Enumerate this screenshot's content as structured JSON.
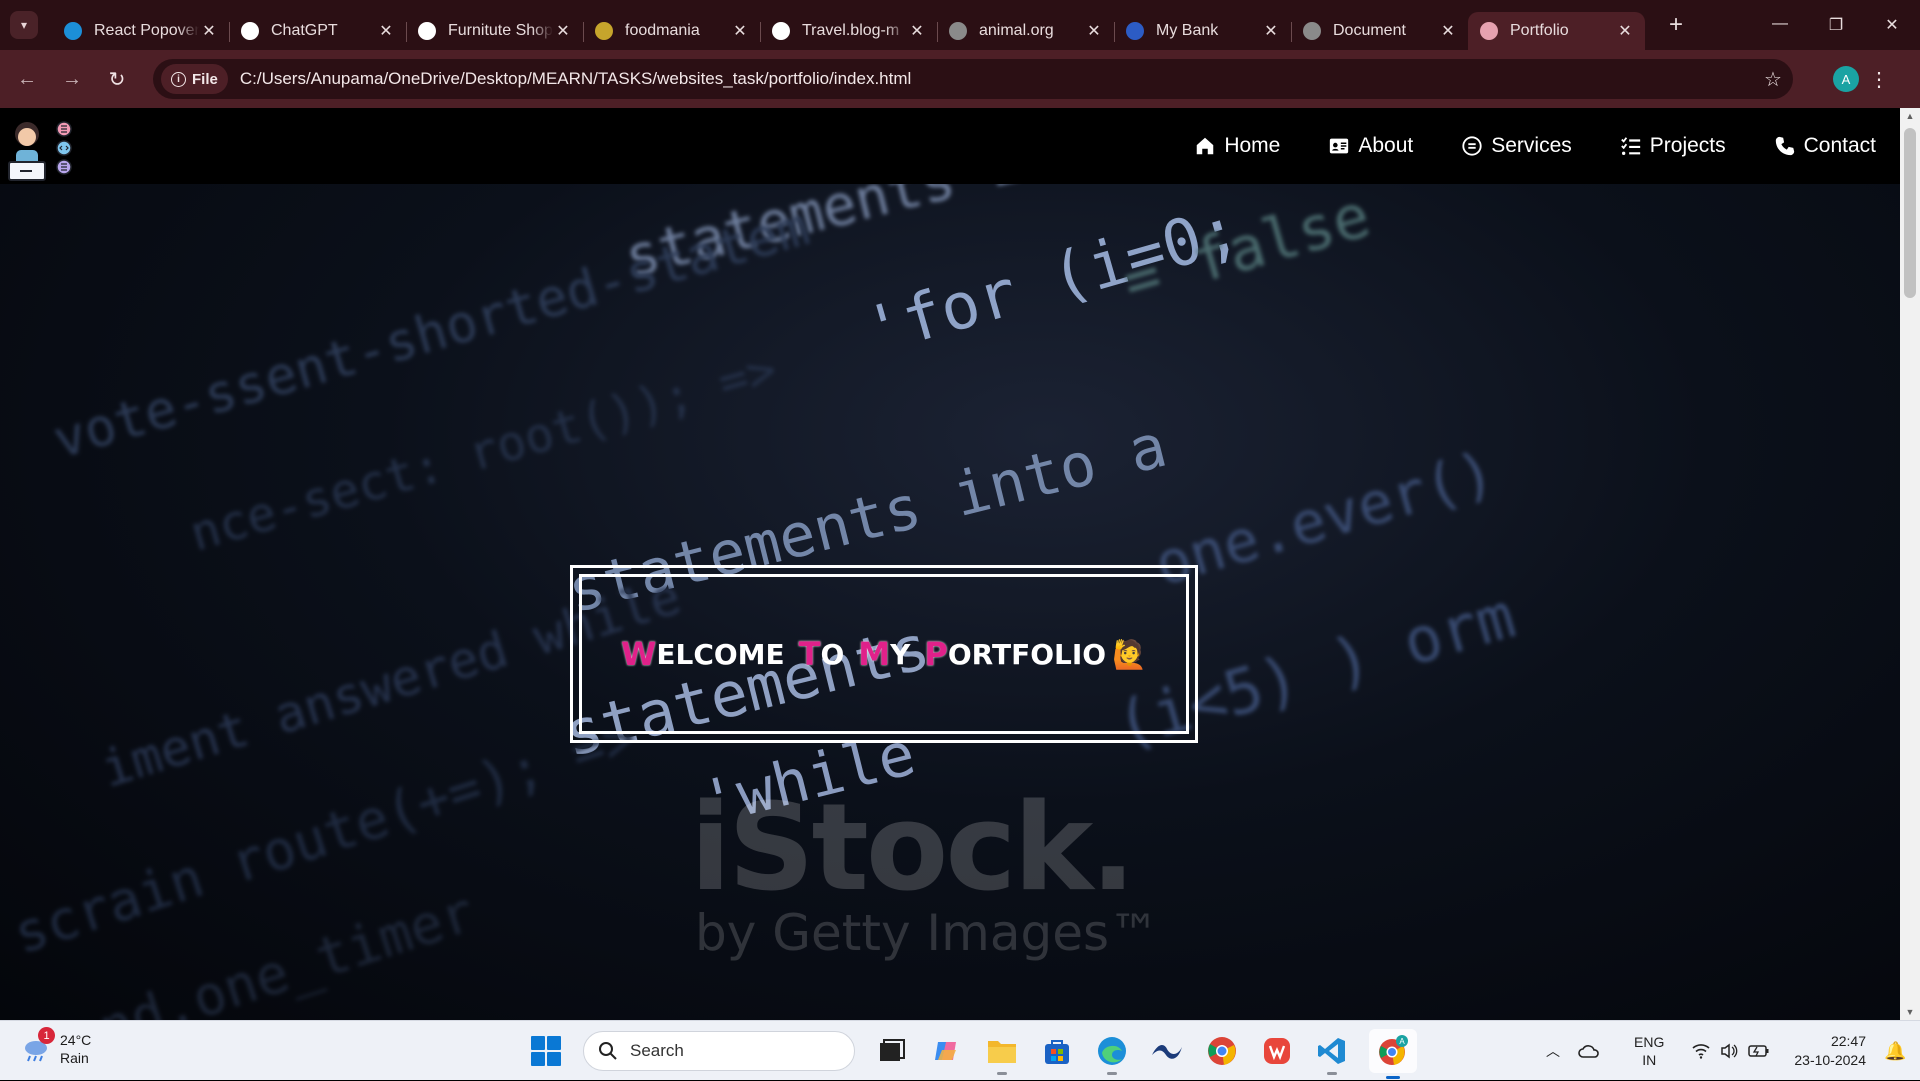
{
  "browser": {
    "tabs": [
      {
        "title": "React Popover",
        "favicon": "react-icon",
        "color": "#1c8fd8"
      },
      {
        "title": "ChatGPT",
        "favicon": "chatgpt-icon",
        "color": "#ffffff"
      },
      {
        "title": "Furnitute Shop",
        "favicon": "furniture-icon",
        "color": "#ffffff"
      },
      {
        "title": "foodmania",
        "favicon": "food-icon",
        "color": "#c6a52c"
      },
      {
        "title": "Travel.blog-m",
        "favicon": "travel-icon",
        "color": "#ffffff"
      },
      {
        "title": "animal.org",
        "favicon": "globe-icon",
        "color": "#8a8a8a"
      },
      {
        "title": "My Bank",
        "favicon": "bank-icon",
        "color": "#2c5cc5"
      },
      {
        "title": "Document",
        "favicon": "globe-icon",
        "color": "#8a8a8a"
      },
      {
        "title": "Portfolio",
        "favicon": "portfolio-icon",
        "color": "#e7a2b0",
        "active": true
      }
    ],
    "address": {
      "chip_label": "File",
      "url": "C:/Users/Anupama/OneDrive/Desktop/MEARN/TASKS/websites_task/portfolio/index.html"
    },
    "profile_initial": "A"
  },
  "site": {
    "nav": [
      {
        "label": "Home",
        "icon": "home-icon"
      },
      {
        "label": "About",
        "icon": "id-card-icon"
      },
      {
        "label": "Services",
        "icon": "services-icon"
      },
      {
        "label": "Projects",
        "icon": "list-check-icon"
      },
      {
        "label": "Contact",
        "icon": "phone-icon"
      }
    ],
    "hero": {
      "words": [
        {
          "cap": "W",
          "rest": "ELCOME"
        },
        {
          "cap": "T",
          "rest": "O"
        },
        {
          "cap": "M",
          "rest": "Y"
        },
        {
          "cap": "P",
          "rest": "ORTFOLIO"
        }
      ],
      "emoji": "🙋",
      "accent_color": "#e0218a",
      "watermark": "iStock.",
      "watermark_sub": "by Getty Images™"
    }
  },
  "taskbar": {
    "weather": {
      "temp": "24°C",
      "condition": "Rain",
      "badge": "1"
    },
    "search_placeholder": "Search",
    "language": {
      "line1": "ENG",
      "line2": "IN"
    },
    "clock": {
      "time": "22:47",
      "date": "23-10-2024"
    }
  }
}
